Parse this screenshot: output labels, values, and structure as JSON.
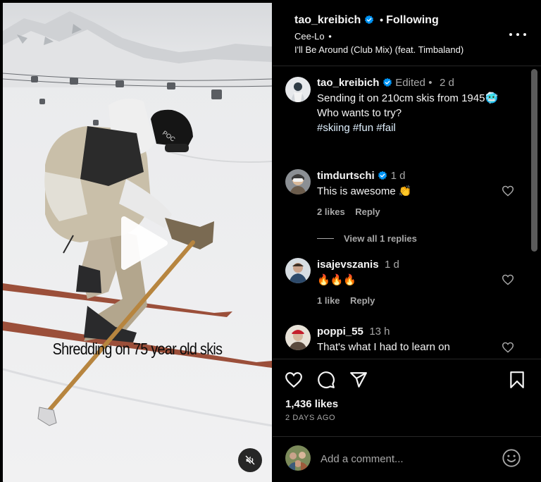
{
  "video": {
    "caption": "Shredding on 75 year old skis",
    "play_icon": "play-icon",
    "mute_icon": "speaker-muted-icon"
  },
  "header": {
    "username": "tao_kreibich",
    "separator": "•",
    "follow_status": "Following",
    "artist": "Cee-Lo",
    "artist_sep": "•",
    "song": "I'll Be Around (Club Mix) (feat. Timbaland)",
    "more_icon": "more-options-icon"
  },
  "post": {
    "username": "tao_kreibich",
    "edited": "Edited",
    "sep": "•",
    "age": "2 d",
    "caption_line1": "Sending it on 210cm skis from 1945🥶",
    "caption_line2": "Who wants to try?",
    "hashtags": [
      "#skiing",
      "#fun",
      "#fail"
    ]
  },
  "comments": [
    {
      "username": "timdurtschi",
      "verified": true,
      "age": "1 d",
      "text": "This is awesome 👏",
      "likes": "2 likes",
      "reply": "Reply",
      "view_replies": "View all 1 replies"
    },
    {
      "username": "isajevszanis",
      "verified": false,
      "age": "1 d",
      "text": "🔥🔥🔥",
      "likes": "1 like",
      "reply": "Reply"
    },
    {
      "username": "poppi_55",
      "verified": false,
      "age": "13 h",
      "text": "That's what I had to learn on"
    }
  ],
  "actions": {
    "likes": "1,436 likes",
    "date": "2 DAYS AGO",
    "icons": [
      "heart-icon",
      "comment-icon",
      "share-icon",
      "bookmark-icon"
    ]
  },
  "add_comment": {
    "placeholder": "Add a comment...",
    "emoji_icon": "emoji-icon"
  },
  "colors": {
    "background": "#000000",
    "text": "#f5f5f5",
    "muted": "#a8a8a8",
    "verified": "#0095f6",
    "divider": "#262626"
  }
}
